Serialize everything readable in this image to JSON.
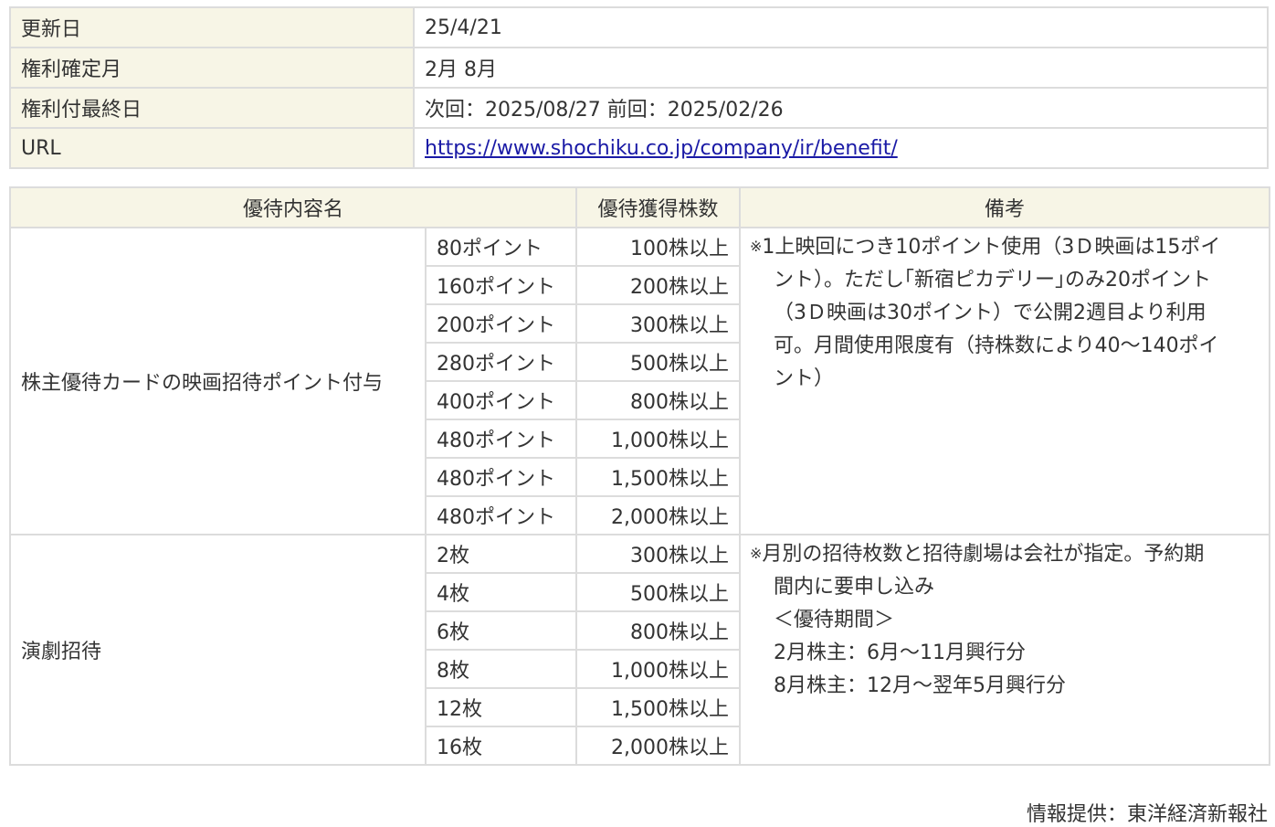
{
  "info": {
    "rows": [
      {
        "label": "更新日",
        "value": "25/4/21"
      },
      {
        "label": "権利確定月",
        "value": "2月 8月"
      },
      {
        "label": "権利付最終日",
        "value": "次回：2025/08/27 前回：2025/02/26"
      },
      {
        "label": "URL",
        "value": "https://www.shochiku.co.jp/company/ir/benefit/"
      }
    ]
  },
  "benefits": {
    "headers": {
      "name": "優待内容名",
      "shares": "優待獲得株数",
      "remarks": "備考"
    },
    "groups": [
      {
        "name": "株主優待カードの映画招待ポイント付与",
        "items": [
          {
            "content": "80ポイント",
            "shares": "100株以上"
          },
          {
            "content": "160ポイント",
            "shares": "200株以上"
          },
          {
            "content": "200ポイント",
            "shares": "300株以上"
          },
          {
            "content": "280ポイント",
            "shares": "500株以上"
          },
          {
            "content": "400ポイント",
            "shares": "800株以上"
          },
          {
            "content": "480ポイント",
            "shares": "1,000株以上"
          },
          {
            "content": "480ポイント",
            "shares": "1,500株以上"
          },
          {
            "content": "480ポイント",
            "shares": "2,000株以上"
          }
        ],
        "remark_mark": "※",
        "remark_lines": [
          "1上映回につき10ポイント使用（3Ｄ映画は15ポイ",
          "ント）。ただし｢新宿ピカデリー｣のみ20ポイント",
          "（3Ｄ映画は30ポイント）で公開2週目より利用",
          "可。月間使用限度有（持株数により40～140ポイ",
          "ント）"
        ]
      },
      {
        "name": "演劇招待",
        "items": [
          {
            "content": "2枚",
            "shares": "300株以上"
          },
          {
            "content": "4枚",
            "shares": "500株以上"
          },
          {
            "content": "6枚",
            "shares": "800株以上"
          },
          {
            "content": "8枚",
            "shares": "1,000株以上"
          },
          {
            "content": "12枚",
            "shares": "1,500株以上"
          },
          {
            "content": "16枚",
            "shares": "2,000株以上"
          }
        ],
        "remark_mark": "※",
        "remark_lines": [
          "月別の招待枚数と招待劇場は会社が指定。予約期",
          "間内に要申し込み",
          "＜優待期間＞",
          "2月株主：6月～11月興行分",
          "8月株主：12月～翌年5月興行分"
        ]
      }
    ]
  },
  "footer": {
    "source": "情報提供：東洋経済新報社"
  }
}
